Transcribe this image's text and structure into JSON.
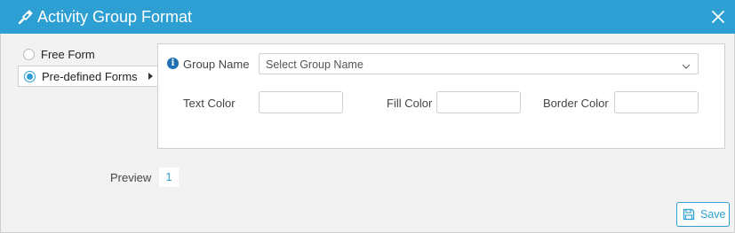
{
  "dialog": {
    "title": "Activity Group Format",
    "accent_color": "#2e9fd3"
  },
  "icons": {
    "title": "paint-brush-icon",
    "close": "close-icon",
    "info": "info-icon",
    "chevron": "chevron-down-icon",
    "save": "floppy-disk-icon"
  },
  "form_type": {
    "options": [
      {
        "label": "Free Form",
        "selected": false
      },
      {
        "label": "Pre-defined Forms",
        "selected": true
      }
    ]
  },
  "group": {
    "label": "Group Name",
    "placeholder": "Select Group Name",
    "info_symbol": "i"
  },
  "colors": {
    "text_label": "Text Color",
    "fill_label": "Fill Color",
    "border_label": "Border Color",
    "text_value": "",
    "fill_value": "",
    "border_value": ""
  },
  "preview": {
    "label": "Preview",
    "sample": "1"
  },
  "actions": {
    "save_label": "Save"
  }
}
